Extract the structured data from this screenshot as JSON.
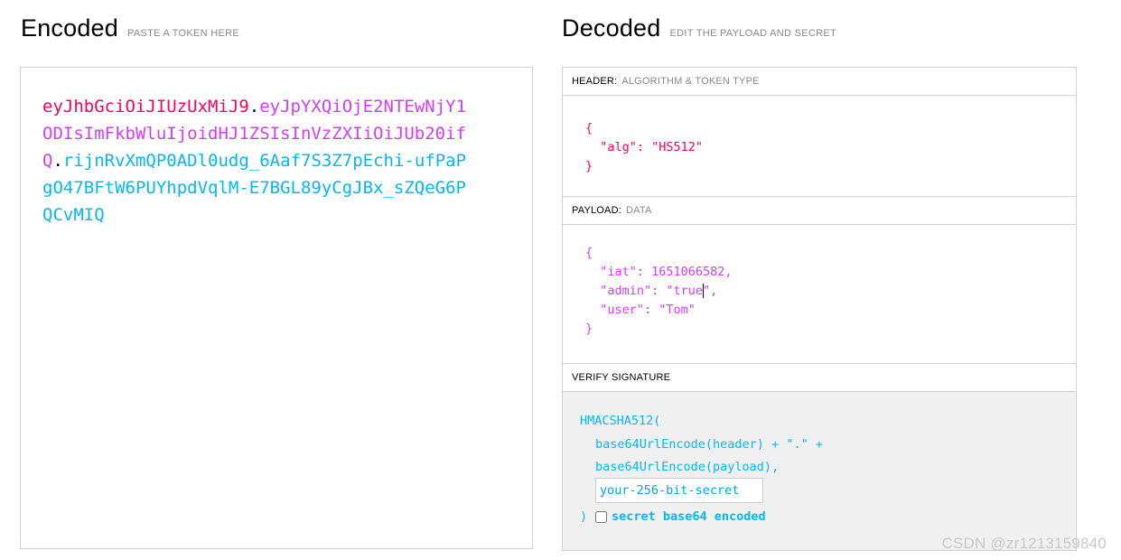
{
  "encoded": {
    "title": "Encoded",
    "hint": "PASTE A TOKEN HERE",
    "token": {
      "header": "eyJhbGciOiJIUzUxMiJ9",
      "payload": "eyJpYXQiOjE2NTEwNjY1ODIsImFkbWluIjoidHJ1ZSIsInVzZXIiOiJUb20ifQ",
      "signature": "rijnRvXmQP0ADl0udg_6Aaf7S3Z7pEchi-ufPaPgO47BFtW6PUYhpdVqlM-E7BGL89yCgJBx_sZQeG6PQCvMIQ",
      "dot": "."
    }
  },
  "decoded": {
    "title": "Decoded",
    "hint": "EDIT THE PAYLOAD AND SECRET",
    "header_section": {
      "label": "HEADER:",
      "sublabel": "ALGORITHM & TOKEN TYPE",
      "json_text": "{\n  \"alg\": \"HS512\"\n}"
    },
    "payload_section": {
      "label": "PAYLOAD:",
      "sublabel": "DATA",
      "json_before_caret": "{\n  \"iat\": 1651066582,\n  \"admin\": \"true",
      "json_after_caret": "\",\n  \"user\": \"Tom\"\n}"
    },
    "verify_section": {
      "label": "VERIFY SIGNATURE",
      "fn_open": "HMACSHA512(",
      "arg_header": "base64UrlEncode(header) + \".\" +",
      "arg_payload": "base64UrlEncode(payload),",
      "secret_placeholder": "your-256-bit-secret",
      "fn_close": ")",
      "base64_label": "secret base64 encoded",
      "base64_checked": false
    }
  },
  "colors": {
    "header": "#fb015b",
    "payload": "#d63aff",
    "signature": "#00b9f1"
  },
  "watermark": "CSDN @zr1213159840"
}
